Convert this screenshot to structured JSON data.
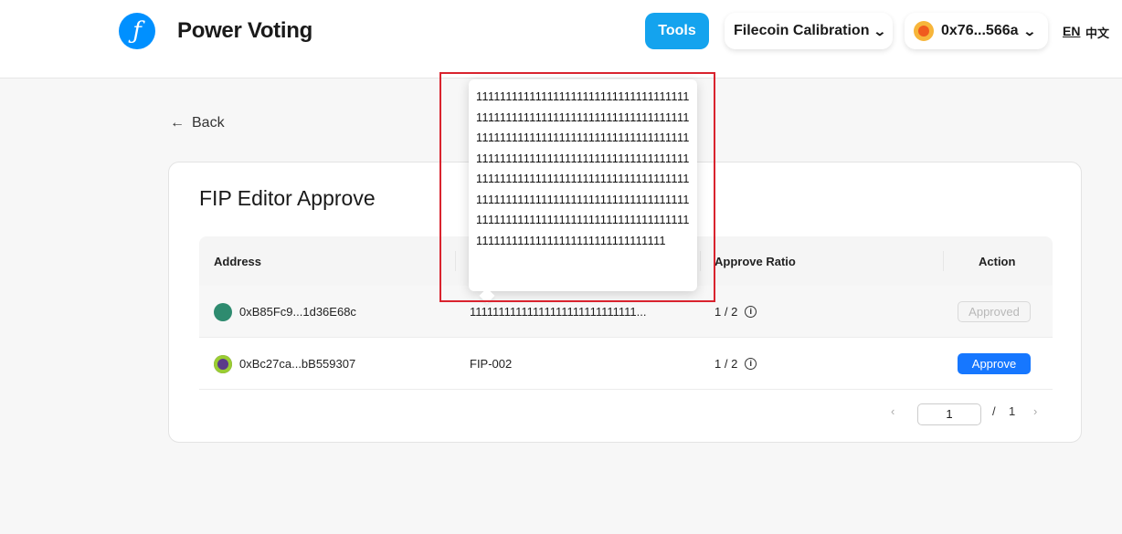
{
  "header": {
    "app_title": "Power Voting",
    "logo_glyph": "ƒ",
    "tools_label": "Tools",
    "network_label": "Filecoin Calibration",
    "account_label": "0x76...566a",
    "lang_en": "EN",
    "lang_zh": "中文"
  },
  "nav": {
    "back_label": "Back"
  },
  "card": {
    "title": "FIP Editor Approve",
    "columns": {
      "address": "Address",
      "approve_ratio": "Approve Ratio",
      "action": "Action"
    },
    "rows": [
      {
        "address": "0xB85Fc9...1d36E68c",
        "fip": "11111111111111111111111111111...",
        "ratio": "1 / 2",
        "action": "Approved",
        "avatar_color": "#2e8b6f"
      },
      {
        "address": "0xBc27ca...bB559307",
        "fip": "FIP-002",
        "ratio": "1 / 2",
        "action": "Approve",
        "avatar_color": "#5b3a8a"
      }
    ]
  },
  "pagination": {
    "current": "1",
    "separator": "/",
    "total": "1"
  },
  "tooltip": {
    "text": "11111111111111111111111111111111111111111111111111111111111111111111111111111111111111111111111111111111111111111111111111111111111111111111111111111111111111111111111111111111111111111111111111111111111111111111111111111111111111111111111111111111111111111111111111111111111111111111"
  },
  "colors": {
    "accent": "#1677ff",
    "tools": "#14a3ee",
    "highlight": "#d9232e"
  }
}
